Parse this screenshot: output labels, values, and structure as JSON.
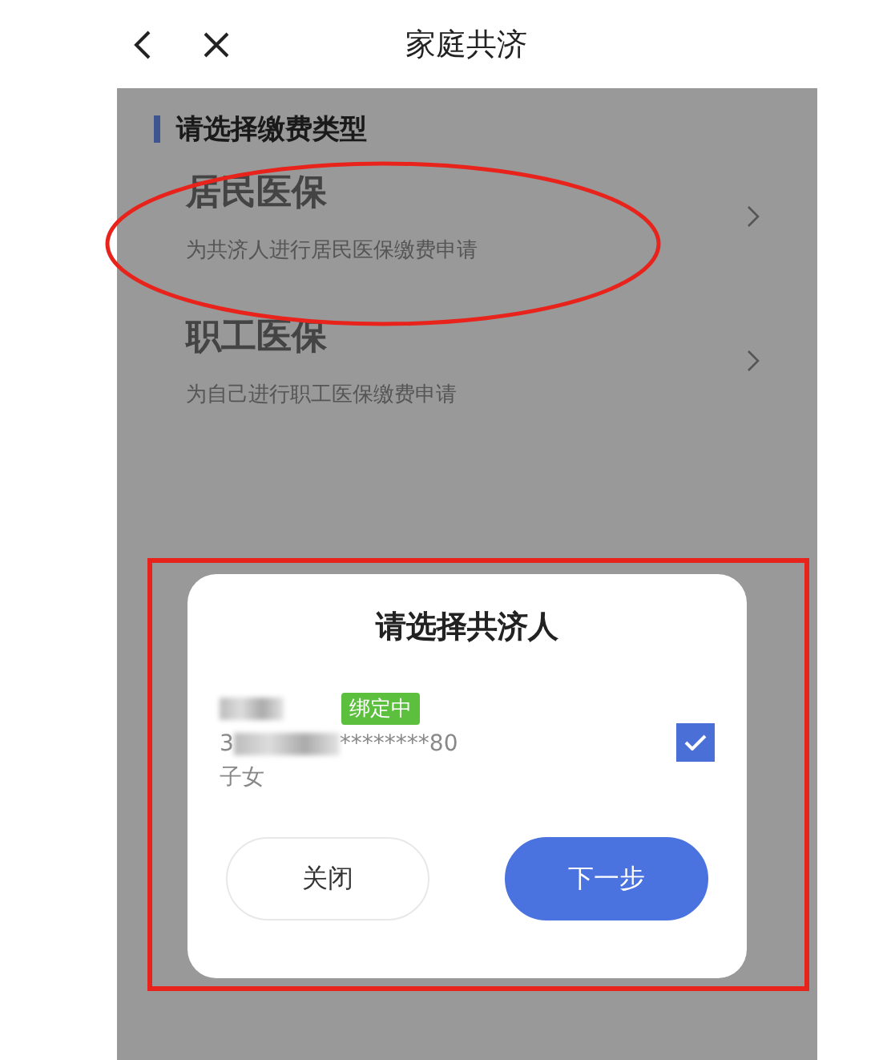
{
  "header": {
    "title": "家庭共济"
  },
  "section": {
    "title": "请选择缴费类型"
  },
  "options": [
    {
      "title": "居民医保",
      "description": "为共济人进行居民医保缴费申请",
      "circled": true
    },
    {
      "title": "职工医保",
      "description": "为自己进行职工医保缴费申请",
      "circled": false
    }
  ],
  "dialog": {
    "title": "请选择共济人",
    "highlighted": true,
    "members": [
      {
        "id_start": "3",
        "id_end": "********80",
        "relation": "子女",
        "badge": "绑定中",
        "checked": true
      }
    ],
    "buttons": [
      {
        "label": "关闭",
        "kind": "secondary"
      },
      {
        "label": "下一步",
        "kind": "primary"
      }
    ]
  }
}
